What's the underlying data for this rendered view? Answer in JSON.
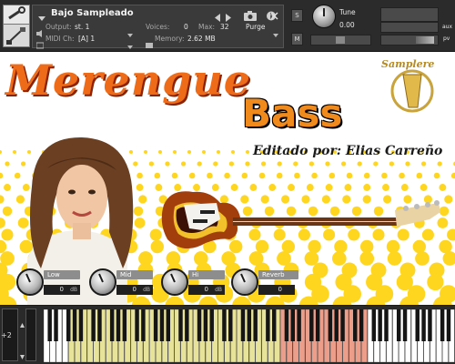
{
  "header": {
    "instrument_name": "Bajo Sampleado",
    "output_label": "Output:",
    "output_value": "st. 1",
    "voices_label": "Voices:",
    "voices_value": "0",
    "max_label": "Max:",
    "max_value": "32",
    "purge_label": "Purge",
    "midi_label": "MIDI Ch:",
    "midi_value": "[A]  1",
    "memory_label": "Memory:",
    "memory_value": "2.62 MB",
    "tune_label": "Tune",
    "tune_value": "0.00",
    "solo": "S",
    "mute": "M",
    "aux": "aux",
    "pv": "pv",
    "pan_value": "L",
    "icons": [
      "wrench-icon",
      "camera-icon",
      "info-icon",
      "close-icon",
      "prev-icon",
      "next-icon"
    ]
  },
  "art": {
    "title_script": "Merengue",
    "title_bass": "Bass",
    "credit": "Editado por: Elias Carreño",
    "logo_text": "Samplere",
    "accent": "#f08a1c",
    "dot_color": "#ffd61f"
  },
  "controls": [
    {
      "label": "Low",
      "value": "0"
    },
    {
      "label": "Mid",
      "value": "0"
    },
    {
      "label": "Hi",
      "value": "0"
    },
    {
      "label": "Reverb",
      "value": "0"
    }
  ],
  "keyboard": {
    "octave_value": "+2",
    "key_colors": {
      "normal": "#ffffff",
      "bass_range": "#e8e39a",
      "keyswitch_range": "#ec9e8a"
    }
  }
}
